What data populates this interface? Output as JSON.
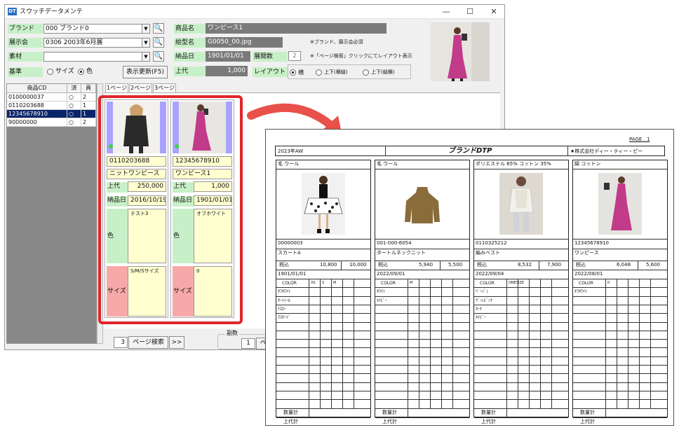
{
  "window": {
    "logo": "DT",
    "title": "スウッチデータメンテ",
    "min": "—",
    "max": "☐",
    "close": "✕"
  },
  "form": {
    "brand_label": "ブランド",
    "brand_value": "000 ブランド0",
    "exhibit_label": "展示会",
    "exhibit_value": "0306 2003年6月展",
    "material_label": "素材",
    "material_value": "",
    "basis_label": "基準",
    "basis_opt1": "サイズ",
    "basis_opt2": "色",
    "refresh_button": "表示更新(F5)",
    "name_label": "商品名",
    "name_value": "ワンピース1",
    "image_label": "絵型名",
    "image_value": "G0050_00.jpg",
    "date_label": "納品日",
    "date_value": "1901/01/01",
    "count_label": "展開数",
    "count_value": "2",
    "price_label": "上代",
    "price_value": "1,000",
    "layout_label": "レイアウト",
    "layout_opt1": "横",
    "layout_opt2": "上下(横縦)",
    "layout_opt3": "上下(縦横)",
    "note1": "※ブランド、展示会必須",
    "note2": "※「ページ検索」クリックにてレイアウト表示"
  },
  "grid": {
    "headers": [
      "商品CD",
      "済",
      "頁"
    ],
    "rows": [
      {
        "cd": "0100000037",
        "done": "○",
        "page": "2"
      },
      {
        "cd": "0110203688",
        "done": "○",
        "page": "1"
      },
      {
        "cd": "12345678910",
        "done": "○",
        "page": "1"
      },
      {
        "cd": "90000000",
        "done": "○",
        "page": "2"
      }
    ]
  },
  "tabs": [
    "1ページ",
    "2ページ",
    "3ページ"
  ],
  "cards": [
    {
      "code": "0110203688",
      "name": "ニットワンピース",
      "price_label": "上代",
      "price": "250,000",
      "date_label": "納品日",
      "date": "2016/10/19",
      "color_label": "色",
      "color": "テスト3",
      "size_label": "サイズ",
      "size": "S/M/Sサイズ"
    },
    {
      "code": "12345678910",
      "name": "ワンピース1",
      "price_label": "上代",
      "price": "1,000",
      "date_label": "納品日",
      "date": "1901/01/01",
      "color_label": "色",
      "color": "オフホワイト",
      "size_label": "サイズ",
      "size": "0"
    }
  ],
  "pager": {
    "page": "3",
    "search_button": "ページ検索",
    "next_button": ">>",
    "copies_label": "副数",
    "copies_value": "1",
    "print_stub": "ペ"
  },
  "report": {
    "page_label": "PAGE . 1",
    "season": "2023年AW",
    "brand": "ブランドDTP",
    "company": "★株式会社ディー・ティー・ピー",
    "tax_label": "税込",
    "color_head": "COLOR",
    "qty_label": "数量計",
    "retail_label": "上代計",
    "columns": [
      {
        "material": "毛 ウール",
        "code": "00000003",
        "name": "スカートA",
        "tax_price": "10,800",
        "price": "10,000",
        "date": "1901/01/01",
        "sizes": [
          "XS",
          "S",
          "M"
        ],
        "colors": [
          "ｵﾌﾎﾜｲﾄ",
          "ｵｰﾄﾐｰﾙ",
          "ｲｴﾛｰ",
          "ﾏｽﾀｰﾄﾞ"
        ]
      },
      {
        "material": "毛 ウール",
        "code": "001-000-6054",
        "name": "タートルネックニット",
        "tax_price": "5,940",
        "price": "5,500",
        "date": "2022/09/01",
        "sizes": [
          "M"
        ],
        "colors": [
          "ﾎﾜｲﾄ",
          "ﾈｲﾋﾞｰ"
        ]
      },
      {
        "material": "ポリエステル 65% コットン 35%",
        "code": "0110325212",
        "name": "編みベスト",
        "tax_price": "8,532",
        "price": "7,900",
        "date": "2022/09/04",
        "sizes": [
          "ONESIZE"
        ],
        "colors": [
          "ﾍﾞｰｼﾞｭ",
          "ｸﾞｰﾚﾋﾟﾝｸ",
          "ｶｰｷ",
          "ﾈｲﾋﾞｰ"
        ]
      },
      {
        "material": "綿 コットン",
        "code": "12345678910",
        "name": "ワンピース",
        "tax_price": "6,048",
        "price": "5,600",
        "date": "2022/08/01",
        "sizes": [
          "0"
        ],
        "colors": [
          "ｵﾌﾎﾜｲﾄ"
        ]
      }
    ]
  }
}
